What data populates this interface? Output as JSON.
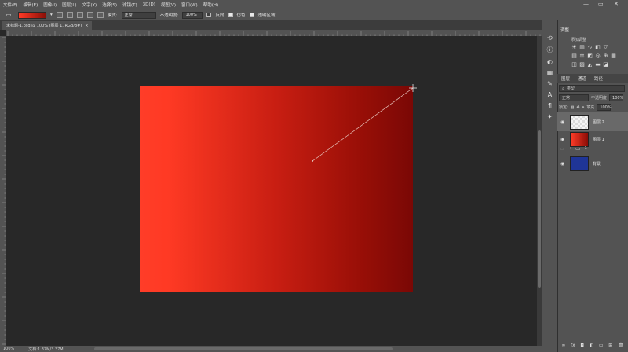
{
  "menu": [
    "文件(F)",
    "编辑(E)",
    "图像(I)",
    "图层(L)",
    "文字(Y)",
    "选择(S)",
    "滤镜(T)",
    "3D(D)",
    "视图(V)",
    "窗口(W)",
    "帮助(H)"
  ],
  "window_controls": {
    "minimize": "—",
    "restore": "▭",
    "close": "✕"
  },
  "options": {
    "mode_label": "模式:",
    "mode_value": "正常",
    "opacity_label": "不透明度:",
    "opacity_value": "100%",
    "reverse_label": "反向",
    "dither_label": "仿色",
    "transparency_label": "透明区域"
  },
  "document_tab": {
    "title": "未标题-1.psd @ 100% (图层 1, RGB/8#)",
    "close": "×"
  },
  "status": {
    "zoom": "100%",
    "doc_size": "文档:1.37M/3.37M"
  },
  "panels": {
    "adjust_tab": "调整",
    "add_adjust_label": "添加调整",
    "layer_tabs": [
      "图层",
      "通道",
      "路径"
    ],
    "kind_label": "类型",
    "blend_mode": "正常",
    "opacity_label": "不透明度",
    "opacity_value": "100%",
    "lock_label": "锁定:",
    "fill_label": "填充",
    "fill_value": "100%"
  },
  "layers": [
    {
      "name": "图层 2",
      "thumb": "transparent",
      "selected": true
    },
    {
      "name": "图层 1",
      "thumb": "red",
      "selected": false
    },
    {
      "name": "1",
      "thumb": "group",
      "selected": false
    },
    {
      "name": "背景",
      "thumb": "blue",
      "selected": false
    }
  ],
  "colors": {
    "gradient_start": "#ff3d28",
    "gradient_end": "#7a0805",
    "background_layer": "#1f3597",
    "ui_panel": "#535353"
  }
}
